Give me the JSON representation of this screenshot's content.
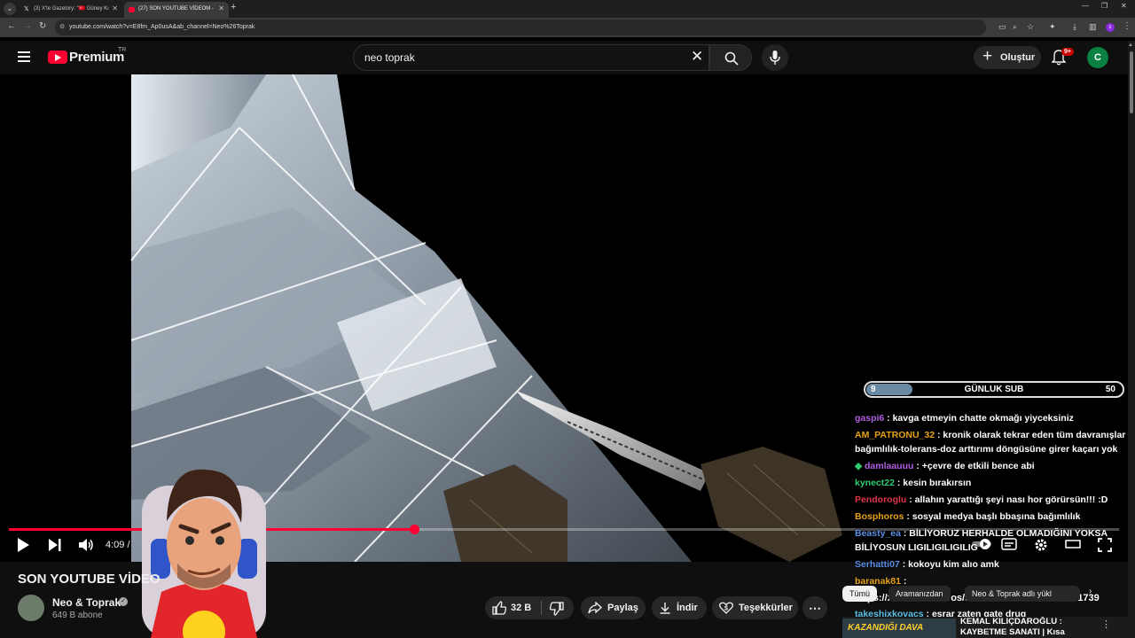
{
  "browser": {
    "tabs": [
      {
        "title": "(3) X'te Gazetory: \"🇹🇷 Güney Kı",
        "active": false
      },
      {
        "title": "(27) SON YOUTUBE VİDEOM -",
        "active": true
      }
    ],
    "url": "youtube.com/watch?v=E8fm_Ap0usA&ab_channel=Neo%26Toprak"
  },
  "header": {
    "brand": "Premium",
    "country": "TR",
    "search_value": "neo toprak",
    "create_label": "Oluştur",
    "notif_count": "9+",
    "avatar_letter": "C"
  },
  "player": {
    "progress": 0.365,
    "time": "4:09 / ",
    "sub_goal": {
      "current": "9",
      "label": "GÜNLUK SUB",
      "target": "50",
      "fraction": 0.18
    },
    "chat": [
      {
        "user": "gaspi6",
        "color": "#b05ee0",
        "text": " : kavga etmeyin chatte okmağı yiyceksiniz"
      },
      {
        "user": "AM_PATRONU_32",
        "color": "#e8a317",
        "text": " : kronik olarak tekrar eden tüm davranışlar bağımlılık-tolerans-doz arttırımı döngüsüne girer kaçarı yok"
      },
      {
        "user": "damlaauuu",
        "color": "#b05ee0",
        "text": " : +çevre de etkili bence abi",
        "emote": "◆ "
      },
      {
        "user": "kynect22",
        "color": "#2ecc71",
        "text": " : kesin bırakırsın"
      },
      {
        "user": "Pendoroglu",
        "color": "#e0344a",
        "text": " : allahın yarattığı şeyi nası hor görürsün!!! :D"
      },
      {
        "user": "Bosphoros",
        "color": "#e8a317",
        "text": " : sosyal medya başlı bbaşına bağımlılık"
      },
      {
        "user": "Beasty_ea",
        "color": "#5b8ee6",
        "text": " : BİLİYORUZ HERHALDE OLMADIĞINI YOKSA BİLİYOSUN LIGILIGILIGILIG"
      },
      {
        "user": "Serhatti07",
        "color": "#5b8ee6",
        "text": " : kokoyu kim alıo amk"
      },
      {
        "user": "baranak81",
        "color": "#e8a317",
        "text": " :"
      }
    ],
    "overlay_url": "https://x.com/1907Bros/status/1966813561964871739",
    "bottom_chat": {
      "user": "takeshixkovacs",
      "color": "#5bc0e6",
      "text": " : esrar zaten gate drug"
    }
  },
  "video": {
    "title": "SON YOUTUBE VİDEO",
    "channel": "Neo & Toprak",
    "subs": "649 B abone",
    "likes": "32 B",
    "share_label": "Paylaş",
    "download_label": "İndir",
    "thanks_label": "Teşekkürler"
  },
  "chips": {
    "all": "Tümü",
    "search": "Aramanızdan",
    "channel": "Neo & Toprak adlı yükl"
  },
  "recommendation": {
    "thumb_text": "KAZANDIĞI DAVA",
    "title": "KEMAL KILIÇDAROĞLU : KAYBETME SANATI | Kısa Özet"
  }
}
